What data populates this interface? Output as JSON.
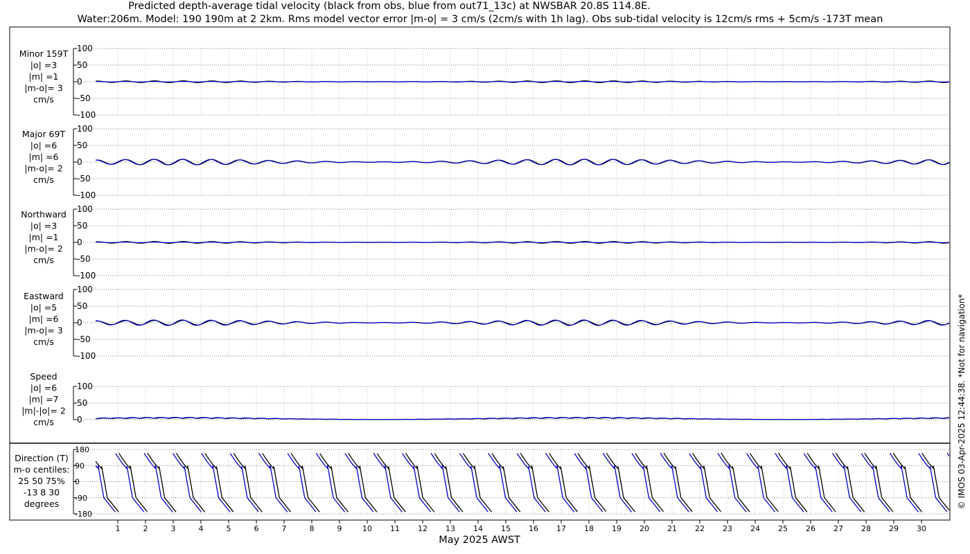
{
  "title_line1": "Predicted depth-average tidal velocity (black from obs, blue from out71_13c) at NWSBAR 20.8S 114.8E.",
  "title_line2": "Water:206m. Model: 190 190m at 2 2km. Rms model vector error |m-o| = 3 cm/s (2cm/s with 1h lag). Obs sub-tidal velocity is 12cm/s rms + 5cm/s -173T mean",
  "xlabel": "May 2025 AWST",
  "credit": "© IMOS 03-Apr-2025 12:44:38. *Not for navigation*",
  "colors": {
    "obs": "#000000",
    "model": "#0000cc",
    "grid": "#555555",
    "frame": "#000000"
  },
  "chart_data": {
    "type": "line",
    "x_ticks": [
      "1",
      "2",
      "3",
      "4",
      "5",
      "6",
      "7",
      "8",
      "9",
      "10",
      "11",
      "12",
      "13",
      "14",
      "15",
      "16",
      "17",
      "18",
      "19",
      "20",
      "21",
      "22",
      "23",
      "24",
      "25",
      "26",
      "27",
      "28",
      "29",
      "30"
    ],
    "x_range_days": [
      0.2,
      31.0
    ],
    "grid": true,
    "series_note": "black from obs, blue from out71_13c",
    "panels": [
      {
        "labels": [
          "Minor 159T",
          "|o| =3",
          "|m| =1",
          "|m-o|= 3",
          "cm/s"
        ],
        "ylim": [
          -100,
          100
        ],
        "yticks": [
          "100",
          "50",
          "0",
          "-50",
          "-100"
        ],
        "obs_amplitude": 3,
        "model_amplitude": 1,
        "unit": "cm/s"
      },
      {
        "labels": [
          "Major 69T",
          "|o| =6",
          "|m| =6",
          "|m-o|= 2",
          "cm/s"
        ],
        "ylim": [
          -100,
          100
        ],
        "yticks": [
          "100",
          "50",
          "0",
          "-50",
          "-100"
        ],
        "obs_amplitude": 6,
        "model_amplitude": 6,
        "unit": "cm/s"
      },
      {
        "labels": [
          "Northward",
          "|o| =3",
          "|m| =1",
          "|m-o|= 2",
          "cm/s"
        ],
        "ylim": [
          -100,
          100
        ],
        "yticks": [
          "100",
          "50",
          "0",
          "-50",
          "-100"
        ],
        "obs_amplitude": 3,
        "model_amplitude": 1,
        "unit": "cm/s"
      },
      {
        "labels": [
          "Eastward",
          "|o| =5",
          "|m| =6",
          "|m-o|= 3",
          "cm/s"
        ],
        "ylim": [
          -100,
          100
        ],
        "yticks": [
          "100",
          "50",
          "0",
          "-50",
          "-100"
        ],
        "obs_amplitude": 5,
        "model_amplitude": 6,
        "unit": "cm/s"
      },
      {
        "labels": [
          "Speed",
          "|o| =6",
          "|m| =7",
          "|m|-|o|= 2",
          "cm/s"
        ],
        "ylim": [
          0,
          100
        ],
        "yticks": [
          "100",
          "50",
          "0"
        ],
        "obs_amplitude": 6,
        "model_amplitude": 7,
        "unit": "cm/s"
      }
    ],
    "direction_panel": {
      "labels": [
        "Direction (T)",
        "m-o centiles:",
        "25  50  75%",
        "-13   8  30",
        "degrees"
      ],
      "ylim": [
        -180,
        180
      ],
      "yticks": [
        "180",
        "90",
        "0",
        "-90",
        "-180"
      ],
      "centiles_pct": [
        25,
        50,
        75
      ],
      "centiles_deg": [
        -13,
        8,
        30
      ]
    }
  }
}
